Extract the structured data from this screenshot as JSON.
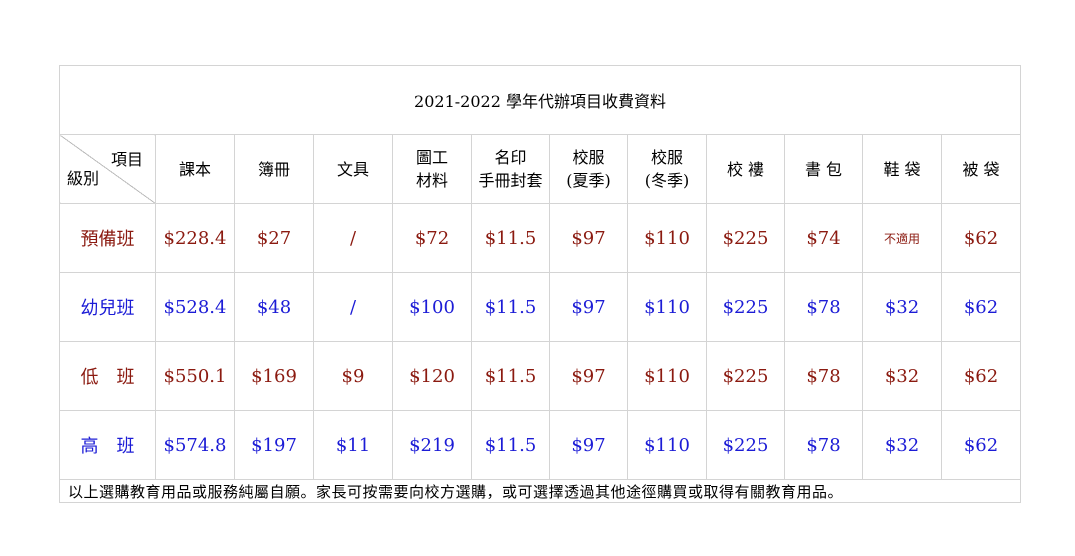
{
  "title": "2021-2022 學年代辦項目收費資料",
  "corner": {
    "top": "項目",
    "bottom": "級別"
  },
  "headers": [
    [
      "課本"
    ],
    [
      "簿冊"
    ],
    [
      "文具"
    ],
    [
      "圖工",
      "材料"
    ],
    [
      "名印",
      "手冊封套"
    ],
    [
      "校服",
      "(夏季)"
    ],
    [
      "校服",
      "(冬季)"
    ],
    [
      "校 褸"
    ],
    [
      "書 包"
    ],
    [
      "鞋 袋"
    ],
    [
      "被 袋"
    ]
  ],
  "rows": [
    {
      "label": "預備班",
      "color": "#8b1a10",
      "values": [
        "$228.4",
        "$27",
        "/",
        "$72",
        "$11.5",
        "$97",
        "$110",
        "$225",
        "$74",
        "不適用",
        "$62"
      ]
    },
    {
      "label": "幼兒班",
      "color": "#1c1cd6",
      "values": [
        "$528.4",
        "$48",
        "/",
        "$100",
        "$11.5",
        "$97",
        "$110",
        "$225",
        "$78",
        "$32",
        "$62"
      ]
    },
    {
      "label": "低　班",
      "color": "#8b1a10",
      "values": [
        "$550.1",
        "$169",
        "$9",
        "$120",
        "$11.5",
        "$97",
        "$110",
        "$225",
        "$78",
        "$32",
        "$62"
      ]
    },
    {
      "label": "高　班",
      "color": "#1c1cd6",
      "values": [
        "$574.8",
        "$197",
        "$11",
        "$219",
        "$11.5",
        "$97",
        "$110",
        "$225",
        "$78",
        "$32",
        "$62"
      ]
    }
  ],
  "note": "以上選購教育用品或服務純屬自願。家長可按需要向校方選購，或可選擇透過其他途徑購買或取得有關教育用品。"
}
